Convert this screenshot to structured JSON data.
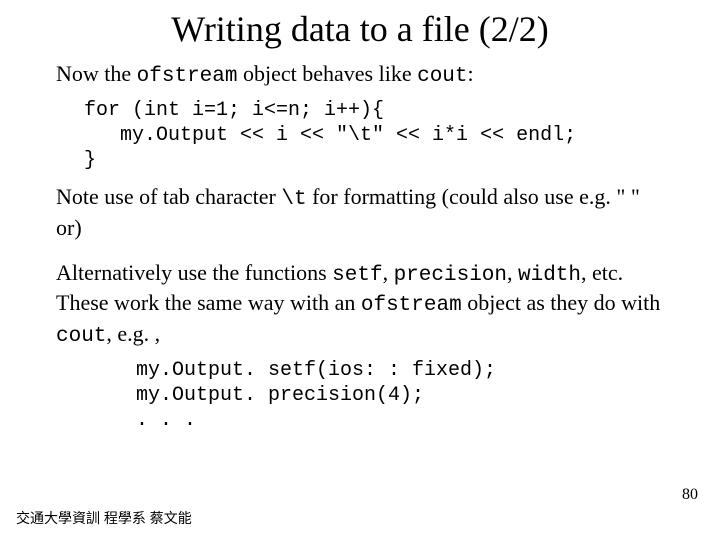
{
  "title": "Writing data to a file (2/2)",
  "intro_pre": "Now the ",
  "intro_code1": "ofstream",
  "intro_mid": " object behaves like ",
  "intro_code2": "cout",
  "intro_post": ":",
  "code1": "for (int i=1; i<=n; i++){\n   my.Output << i << \"\\t\" << i*i << endl;\n}",
  "note_pre": "Note use of tab character ",
  "note_code": "\\t",
  "note_post": " for formatting (could also use e.g. \"   \" or)",
  "alt_1": "Alternatively use the functions ",
  "alt_c1": "setf",
  "alt_2": ", ",
  "alt_c2": "precision",
  "alt_3": ", ",
  "alt_c3": "width",
  "alt_4": ", etc.  These work the same way with an ",
  "alt_c4": "ofstream",
  "alt_5": " object as they do with ",
  "alt_c5": "cout",
  "alt_6": ", e.g. ,",
  "code2": "my.Output. setf(ios: : fixed);\nmy.Output. precision(4);\n. . .",
  "footer": "交通大學資訓 程學系 蔡文能",
  "page": "80"
}
